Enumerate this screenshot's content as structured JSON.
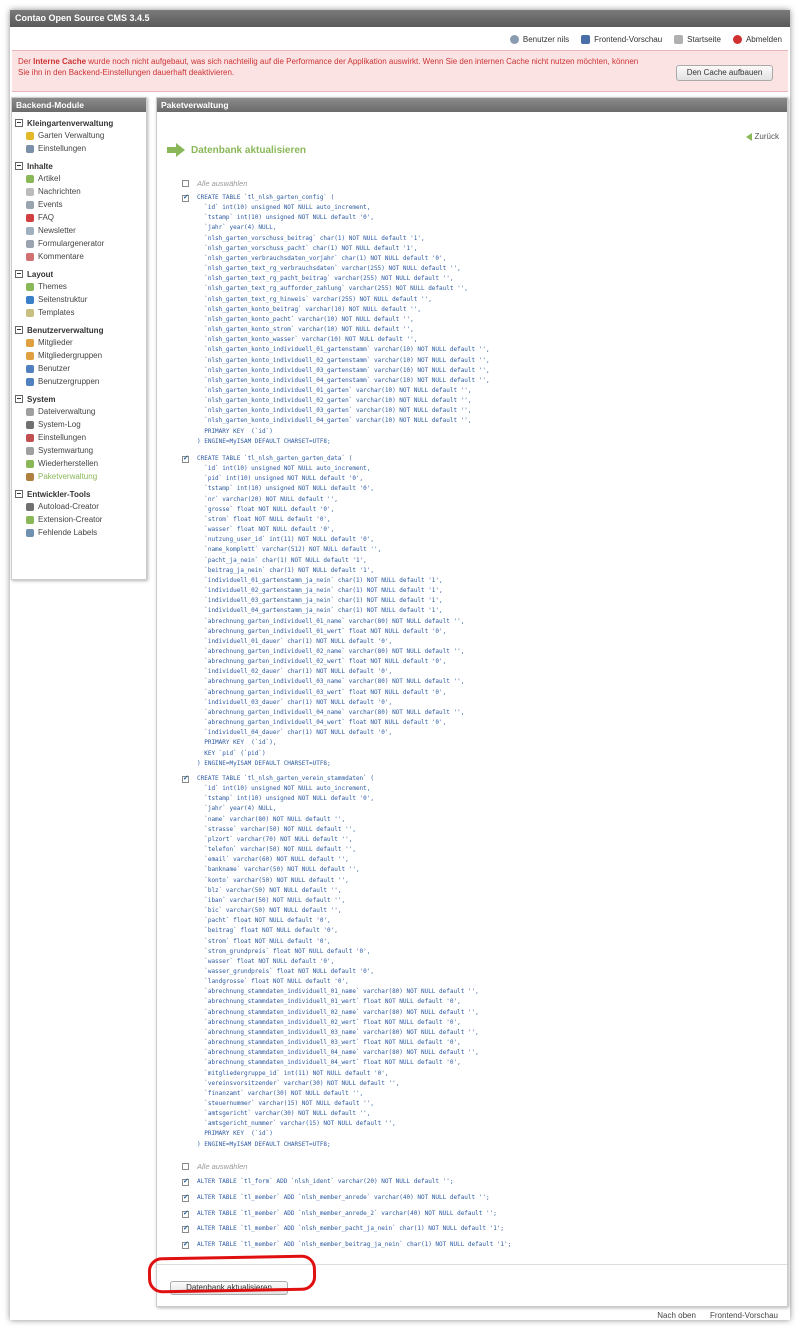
{
  "app_title": "Contao Open Source CMS 3.4.5",
  "topnav": [
    {
      "label": "Benutzer nils",
      "icon": "user-icon"
    },
    {
      "label": "Frontend-Vorschau",
      "icon": "flag-icon"
    },
    {
      "label": "Startseite",
      "icon": "home-icon"
    },
    {
      "label": "Abmelden",
      "icon": "logout-icon"
    }
  ],
  "notice": {
    "before": "Der ",
    "bold": "Interne Cache",
    "after": " wurde noch nicht aufgebaut, was sich nachteilig auf die Performance der Applikation auswirkt. Wenn Sie den internen Cache nicht nutzen möchten, können Sie ihn in den Backend-Einstellungen dauerhaft deaktivieren.",
    "button": "Den Cache aufbauen"
  },
  "sidebar": {
    "title": "Backend-Module",
    "groups": [
      {
        "title": "Kleingartenverwaltung",
        "items": [
          {
            "label": "Garten Verwaltung",
            "icon": "garden-icon",
            "color": "#e5b82a"
          },
          {
            "label": "Einstellungen",
            "icon": "wrench-icon",
            "color": "#7a8fa8"
          }
        ]
      },
      {
        "title": "Inhalte",
        "items": [
          {
            "label": "Artikel",
            "icon": "article-icon",
            "color": "#8ab858"
          },
          {
            "label": "Nachrichten",
            "icon": "news-icon",
            "color": "#bbbbbb"
          },
          {
            "label": "Events",
            "icon": "calendar-icon",
            "color": "#9aa4b0"
          },
          {
            "label": "FAQ",
            "icon": "faq-icon",
            "color": "#d04040"
          },
          {
            "label": "Newsletter",
            "icon": "newsletter-icon",
            "color": "#a0b0c0"
          },
          {
            "label": "Formulargenerator",
            "icon": "form-icon",
            "color": "#9aa4b0"
          },
          {
            "label": "Kommentare",
            "icon": "comment-icon",
            "color": "#d07070"
          }
        ]
      },
      {
        "title": "Layout",
        "items": [
          {
            "label": "Themes",
            "icon": "theme-icon",
            "color": "#8ab858"
          },
          {
            "label": "Seitenstruktur",
            "icon": "globe-icon",
            "color": "#3a80c8"
          },
          {
            "label": "Templates",
            "icon": "template-icon",
            "color": "#c8c080"
          }
        ]
      },
      {
        "title": "Benutzerverwaltung",
        "items": [
          {
            "label": "Mitglieder",
            "icon": "member-icon",
            "color": "#e0a040"
          },
          {
            "label": "Mitgliedergruppen",
            "icon": "member-group-icon",
            "color": "#e0a040"
          },
          {
            "label": "Benutzer",
            "icon": "user-icon",
            "color": "#5080c0"
          },
          {
            "label": "Benutzergruppen",
            "icon": "user-group-icon",
            "color": "#5080c0"
          }
        ]
      },
      {
        "title": "System",
        "items": [
          {
            "label": "Dateiverwaltung",
            "icon": "files-icon",
            "color": "#a0a0a0"
          },
          {
            "label": "System-Log",
            "icon": "log-icon",
            "color": "#707070"
          },
          {
            "label": "Einstellungen",
            "icon": "settings-icon",
            "color": "#c05050"
          },
          {
            "label": "Systemwartung",
            "icon": "maintenance-icon",
            "color": "#a0a0a0"
          },
          {
            "label": "Wiederherstellen",
            "icon": "undo-icon",
            "color": "#8ab858"
          },
          {
            "label": "Paketverwaltung",
            "icon": "package-icon",
            "color": "#b08040",
            "active": true
          }
        ]
      },
      {
        "title": "Entwickler-Tools",
        "items": [
          {
            "label": "Autoload-Creator",
            "icon": "autoload-icon",
            "color": "#707070"
          },
          {
            "label": "Extension-Creator",
            "icon": "extension-icon",
            "color": "#8ab858"
          },
          {
            "label": "Fehlende Labels",
            "icon": "labels-icon",
            "color": "#7090b0"
          }
        ]
      }
    ]
  },
  "main": {
    "title": "Paketverwaltung",
    "back": "Zurück",
    "heading": "Datenbank aktualisieren",
    "select_all": "Alle auswählen",
    "sql_blocks": [
      "CREATE TABLE `tl_nlsh_garten_config` (\n  `id` int(10) unsigned NOT NULL auto_increment,\n  `tstamp` int(10) unsigned NOT NULL default '0',\n  `jahr` year(4) NULL,\n  `nlsh_garten_vorschuss_beitrag` char(1) NOT NULL default '1',\n  `nlsh_garten_vorschuss_pacht` char(1) NOT NULL default '1',\n  `nlsh_garten_verbrauchsdaten_vorjahr` char(1) NOT NULL default '0',\n  `nlsh_garten_text_rg_verbrauchsdaten` varchar(255) NOT NULL default '',\n  `nlsh_garten_text_rg_pacht_beitrag` varchar(255) NOT NULL default '',\n  `nlsh_garten_text_rg_aufforder_zahlung` varchar(255) NOT NULL default '',\n  `nlsh_garten_text_rg_hinweis` varchar(255) NOT NULL default '',\n  `nlsh_garten_konto_beitrag` varchar(10) NOT NULL default '',\n  `nlsh_garten_konto_pacht` varchar(10) NOT NULL default '',\n  `nlsh_garten_konto_strom` varchar(10) NOT NULL default '',\n  `nlsh_garten_konto_wasser` varchar(10) NOT NULL default '',\n  `nlsh_garten_konto_individuell_01_gartenstamm` varchar(10) NOT NULL default '',\n  `nlsh_garten_konto_individuell_02_gartenstamm` varchar(10) NOT NULL default '',\n  `nlsh_garten_konto_individuell_03_gartenstamm` varchar(10) NOT NULL default '',\n  `nlsh_garten_konto_individuell_04_gartenstamm` varchar(10) NOT NULL default '',\n  `nlsh_garten_konto_individuell_01_garten` varchar(10) NOT NULL default '',\n  `nlsh_garten_konto_individuell_02_garten` varchar(10) NOT NULL default '',\n  `nlsh_garten_konto_individuell_03_garten` varchar(10) NOT NULL default '',\n  `nlsh_garten_konto_individuell_04_garten` varchar(10) NOT NULL default '',\n  PRIMARY KEY  (`id`)\n) ENGINE=MyISAM DEFAULT CHARSET=UTF8;",
      "CREATE TABLE `tl_nlsh_garten_garten_data` (\n  `id` int(10) unsigned NOT NULL auto_increment,\n  `pid` int(10) unsigned NOT NULL default '0',\n  `tstamp` int(10) unsigned NOT NULL default '0',\n  `nr` varchar(20) NOT NULL default '',\n  `grosse` float NOT NULL default '0',\n  `strom` float NOT NULL default '0',\n  `wasser` float NOT NULL default '0',\n  `nutzung_user_id` int(11) NOT NULL default '0',\n  `name_komplett` varchar(512) NOT NULL default '',\n  `pacht_ja_nein` char(1) NOT NULL default '1',\n  `beitrag_ja_nein` char(1) NOT NULL default '1',\n  `individuell_01_gartenstamm_ja_nein` char(1) NOT NULL default '1',\n  `individuell_02_gartenstamm_ja_nein` char(1) NOT NULL default '1',\n  `individuell_03_gartenstamm_ja_nein` char(1) NOT NULL default '1',\n  `individuell_04_gartenstamm_ja_nein` char(1) NOT NULL default '1',\n  `abrechnung_garten_individuell_01_name` varchar(80) NOT NULL default '',\n  `abrechnung_garten_individuell_01_wert` float NOT NULL default '0',\n  `individuell_01_dauer` char(1) NOT NULL default '0',\n  `abrechnung_garten_individuell_02_name` varchar(80) NOT NULL default '',\n  `abrechnung_garten_individuell_02_wert` float NOT NULL default '0',\n  `individuell_02_dauer` char(1) NOT NULL default '0',\n  `abrechnung_garten_individuell_03_name` varchar(80) NOT NULL default '',\n  `abrechnung_garten_individuell_03_wert` float NOT NULL default '0',\n  `individuell_03_dauer` char(1) NOT NULL default '0',\n  `abrechnung_garten_individuell_04_name` varchar(80) NOT NULL default '',\n  `abrechnung_garten_individuell_04_wert` float NOT NULL default '0',\n  `individuell_04_dauer` char(1) NOT NULL default '0',\n  PRIMARY KEY  (`id`),\n  KEY `pid` (`pid`)\n) ENGINE=MyISAM DEFAULT CHARSET=UTF8;",
      "CREATE TABLE `tl_nlsh_garten_verein_stammdaten` (\n  `id` int(10) unsigned NOT NULL auto_increment,\n  `tstamp` int(10) unsigned NOT NULL default '0',\n  `jahr` year(4) NULL,\n  `name` varchar(80) NOT NULL default '',\n  `strasse` varchar(50) NOT NULL default '',\n  `plzort` varchar(70) NOT NULL default '',\n  `telefon` varchar(50) NOT NULL default '',\n  `email` varchar(60) NOT NULL default '',\n  `bankname` varchar(50) NOT NULL default '',\n  `konto` varchar(50) NOT NULL default '',\n  `blz` varchar(50) NOT NULL default '',\n  `iban` varchar(50) NOT NULL default '',\n  `bic` varchar(50) NOT NULL default '',\n  `pacht` float NOT NULL default '0',\n  `beitrag` float NOT NULL default '0',\n  `strom` float NOT NULL default '0',\n  `strom_grundpreis` float NOT NULL default '0',\n  `wasser` float NOT NULL default '0',\n  `wasser_grundpreis` float NOT NULL default '0',\n  `landgrosse` float NOT NULL default '0',\n  `abrechnung_stammdaten_individuell_01_name` varchar(80) NOT NULL default '',\n  `abrechnung_stammdaten_individuell_01_wert` float NOT NULL default '0',\n  `abrechnung_stammdaten_individuell_02_name` varchar(80) NOT NULL default '',\n  `abrechnung_stammdaten_individuell_02_wert` float NOT NULL default '0',\n  `abrechnung_stammdaten_individuell_03_name` varchar(80) NOT NULL default '',\n  `abrechnung_stammdaten_individuell_03_wert` float NOT NULL default '0',\n  `abrechnung_stammdaten_individuell_04_name` varchar(80) NOT NULL default '',\n  `abrechnung_stammdaten_individuell_04_wert` float NOT NULL default '0',\n  `mitgliedergruppe_id` int(11) NOT NULL default '0',\n  `vereinsvorsitzender` varchar(30) NOT NULL default '',\n  `finanzamt` varchar(30) NOT NULL default '',\n  `steuernummer` varchar(15) NOT NULL default '',\n  `amtsgericht` varchar(30) NOT NULL default '',\n  `amtsgericht_nummer` varchar(15) NOT NULL default '',\n  PRIMARY KEY  (`id`)\n) ENGINE=MyISAM DEFAULT CHARSET=UTF8;"
    ],
    "select_all_2": "Alle auswählen",
    "alter_statements": [
      "ALTER TABLE `tl_form` ADD `nlsh_ident` varchar(20) NOT NULL default '';",
      "ALTER TABLE `tl_member` ADD `nlsh_member_anrede` varchar(40) NOT NULL default '';",
      "ALTER TABLE `tl_member` ADD `nlsh_member_anrede_2` varchar(40) NOT NULL default '';",
      "ALTER TABLE `tl_member` ADD `nlsh_member_pacht_ja_nein` char(1) NOT NULL default '1';",
      "ALTER TABLE `tl_member` ADD `nlsh_member_beitrag_ja_nein` char(1) NOT NULL default '1';"
    ],
    "submit": "Datenbank aktualisieren"
  },
  "footer": {
    "top": "Nach oben",
    "preview": "Frontend-Vorschau"
  }
}
